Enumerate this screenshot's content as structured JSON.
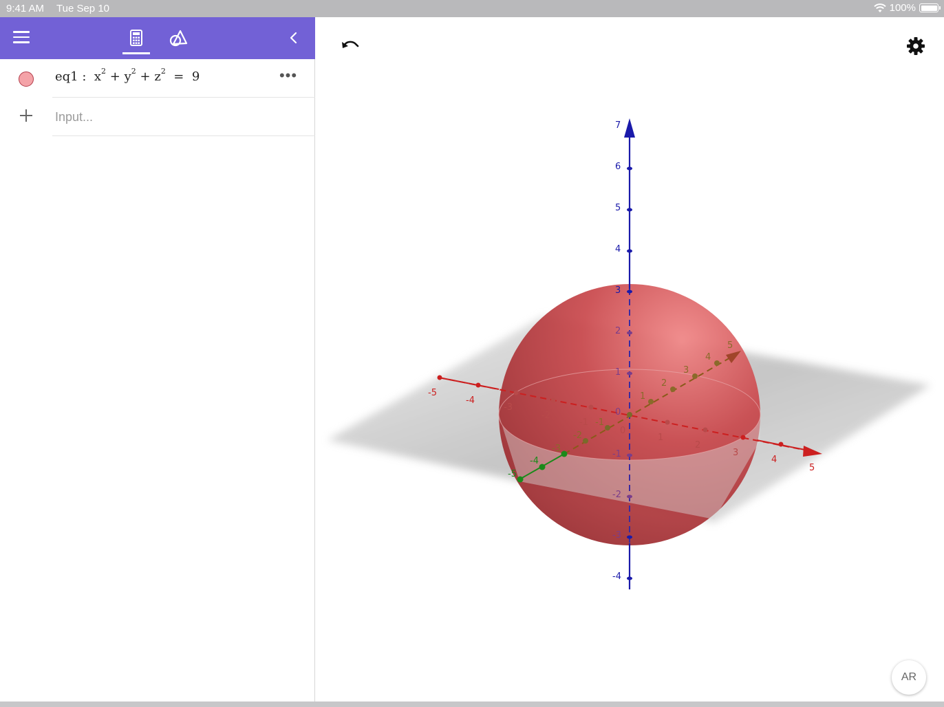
{
  "status_bar": {
    "time": "9:41 AM",
    "date": "Tue Sep 10",
    "battery": "100%"
  },
  "algebra": {
    "row": {
      "label": "eq1 :",
      "x": "x",
      "y": "y",
      "z": "z",
      "exponent": "2",
      "plus": "+",
      "equals": "=",
      "rhs": "9",
      "color": "#f4a3a8"
    },
    "input_placeholder": "Input..."
  },
  "graphics": {
    "ar_label": "AR",
    "accent_colors": {
      "x_axis": "#cc1f1f",
      "y_axis": "#1a8a1a",
      "z_axis": "#1a1aaa",
      "sphere": "#c0383c",
      "toolbar": "#7261d6"
    },
    "z_axis_ticks": [
      "7",
      "6",
      "5",
      "4",
      "3",
      "2",
      "1",
      "0",
      "-1",
      "-2",
      "-3",
      "-4"
    ],
    "x_axis_ticks": [
      "-5",
      "-4",
      "-3",
      "-2",
      "-1",
      "0",
      "1",
      "2",
      "3",
      "4",
      "5"
    ],
    "y_axis_ticks": [
      "-5",
      "-4",
      "-3",
      "-2",
      "-1",
      "1",
      "2",
      "3",
      "4",
      "5"
    ]
  }
}
